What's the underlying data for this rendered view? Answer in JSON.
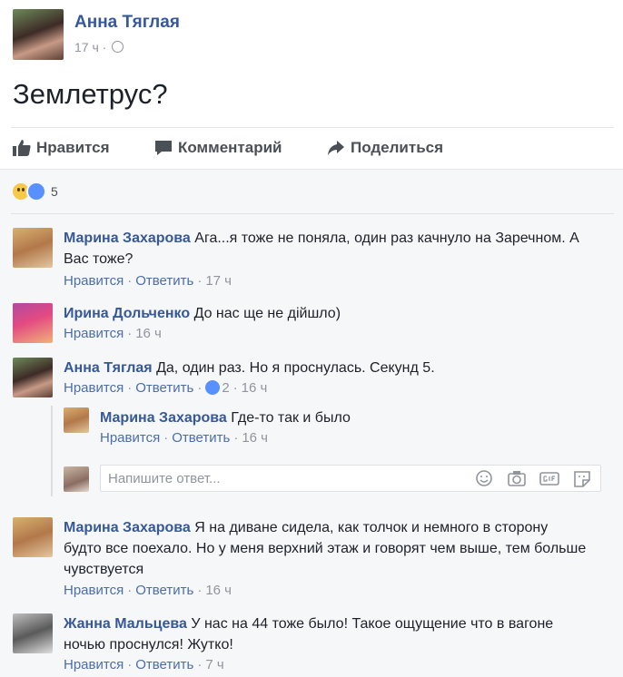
{
  "post": {
    "author": "Анна Тяглая",
    "time": "17 ч",
    "text": "Землетрус?",
    "actions": {
      "like": "Нравится",
      "comment": "Комментарий",
      "share": "Поделиться"
    },
    "reactions_count": "5"
  },
  "comments": [
    {
      "name": "Марина Захарова",
      "text": "Ага...я тоже не поняла, один раз качнуло на Заречном. А",
      "text2": "Вас тоже?",
      "like": "Нравится",
      "reply": "Ответить",
      "time": "17 ч"
    },
    {
      "name": "Ирина Дольченко",
      "text": "До нас ще не дійшло)",
      "like": "Нравится",
      "time": "16 ч"
    },
    {
      "name": "Анна Тяглая",
      "text": "Да, один раз. Но я проснулась. Секунд 5.",
      "like": "Нравится",
      "reply": "Ответить",
      "likes": "2",
      "time": "16 ч"
    },
    {
      "name": "Марина Захарова",
      "text": "Я на диване сидела, как толчок и немного в сторону",
      "text2": "будто все поехало. Но у меня верхний этаж и говорят чем выше, тем больше",
      "text3": "чувствуется",
      "like": "Нравится",
      "reply": "Ответить",
      "time": "16 ч"
    },
    {
      "name": "Жанна Мальцева",
      "text": "У нас на 44 тоже было! Такое ощущение что в вагоне",
      "text2": "ночью проснулся! Жутко!",
      "like": "Нравится",
      "reply": "Ответить",
      "time": "7 ч"
    }
  ],
  "reply": {
    "name": "Марина Захарова",
    "text": "Где-то так и было",
    "like": "Нравится",
    "reply": "Ответить",
    "time": "16 ч"
  },
  "reply_input": {
    "placeholder": "Напишите ответ..."
  }
}
